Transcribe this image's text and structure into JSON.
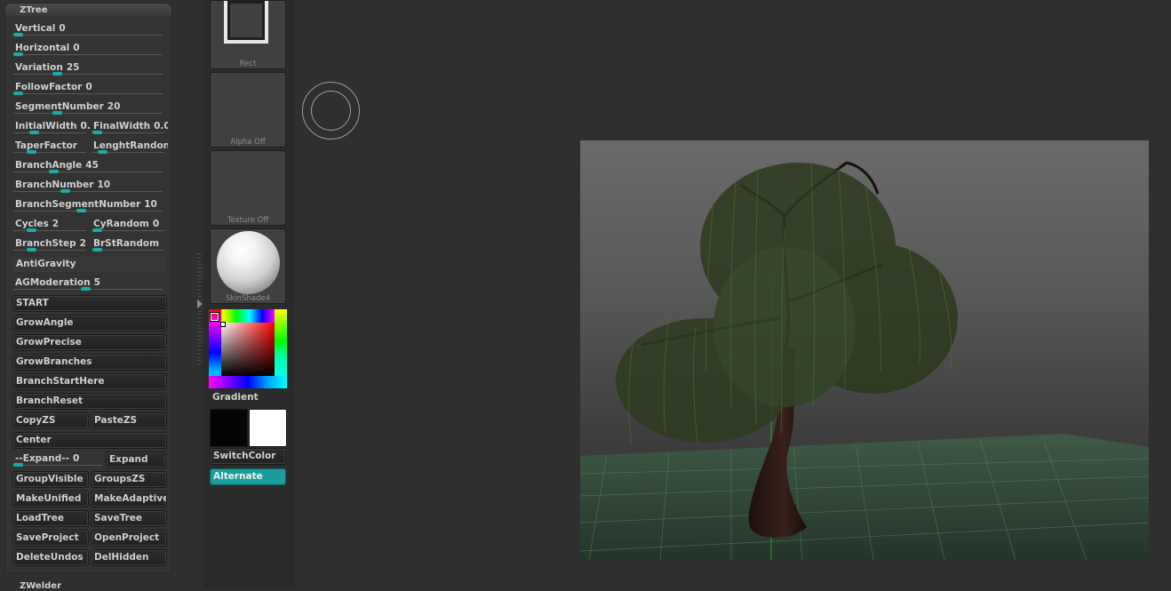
{
  "panel": {
    "title": "ZTree",
    "next_panel_title": "ZWelder"
  },
  "sliders": [
    {
      "label": "Vertical",
      "value": "0"
    },
    {
      "label": "Horizontal",
      "value": "0"
    },
    {
      "label": "Variation",
      "value": "25"
    },
    {
      "label": "FollowFactor",
      "value": "0"
    },
    {
      "label": "SegmentNumber",
      "value": "20"
    },
    {
      "label": "InitialWidth",
      "value": "0."
    },
    {
      "label": "FinalWidth",
      "value": "0.0:"
    },
    {
      "label": "TaperFactor",
      "value": ""
    },
    {
      "label": "LenghtRandon",
      "value": ""
    },
    {
      "label": "BranchAngle",
      "value": "45"
    },
    {
      "label": "BranchNumber",
      "value": "10"
    },
    {
      "label": "BranchSegmentNumber",
      "value": "10"
    },
    {
      "label": "Cycles",
      "value": "2"
    },
    {
      "label": "CyRandom",
      "value": "0"
    },
    {
      "label": "BranchStep",
      "value": "2"
    },
    {
      "label": "BrStRandom",
      "value": ""
    },
    {
      "label": "AGModeration",
      "value": "5"
    },
    {
      "label": "--Expand--",
      "value": "0"
    }
  ],
  "toggles": {
    "antigravity": "AntiGravity"
  },
  "buttons": {
    "start": "START",
    "grow_angle": "GrowAngle",
    "grow_precise": "GrowPrecise",
    "grow_branches": "GrowBranches",
    "branch_start_here": "BranchStartHere",
    "branch_reset": "BranchReset",
    "copy_zs": "CopyZS",
    "paste_zs": "PasteZS",
    "center": "Center",
    "expand": "Expand",
    "group_visible": "GroupVisible",
    "groups_zs": "GroupsZS",
    "make_unified": "MakeUnified",
    "make_adaptive": "MakeAdaptive",
    "load_tree": "LoadTree",
    "save_tree": "SaveTree",
    "save_project": "SaveProject",
    "open_project": "OpenProject",
    "delete_undos": "DeleteUndos",
    "del_hidden": "DelHidden"
  },
  "shelf": {
    "stroke_caption": "Rect",
    "alpha_caption": "Alpha  Off",
    "texture_caption": "Texture  Off",
    "material_caption": "SkinShade4",
    "gradient_label": "Gradient",
    "switch_color": "SwitchColor",
    "alternate": "Alternate"
  },
  "colors": {
    "accent": "#1fa9a7",
    "main_color": "#050505",
    "secondary_color": "#ffffff"
  }
}
